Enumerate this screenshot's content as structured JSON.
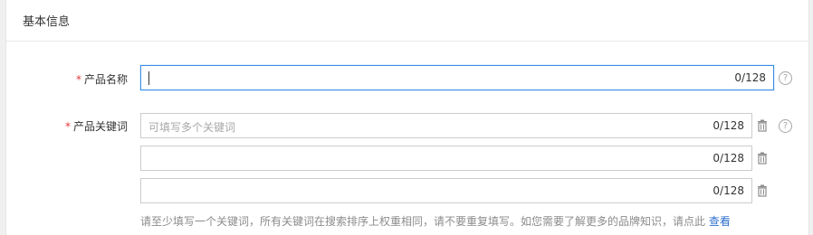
{
  "section": {
    "title": "基本信息"
  },
  "form": {
    "product_name": {
      "required_mark": "*",
      "label": "产品名称",
      "value": "",
      "counter": "0/128",
      "help_icon": "question-circle-icon"
    },
    "keywords": {
      "required_mark": "*",
      "label": "产品关键词",
      "fields": [
        {
          "value": "",
          "placeholder": "可填写多个关键词",
          "counter": "0/128"
        },
        {
          "value": "",
          "placeholder": "",
          "counter": "0/128"
        },
        {
          "value": "",
          "placeholder": "",
          "counter": "0/128"
        }
      ],
      "delete_icon": "trash-icon",
      "help_icon": "question-circle-icon",
      "hint_text": "请至少填写一个关键词，所有关键词在搜索排序上权重相同，请不要重复填写。如您需要了解更多的品牌知识，请点此 ",
      "hint_link": "查看"
    }
  },
  "colors": {
    "required": "#e4393c",
    "focus_border": "#3a8ee6",
    "link": "#2f6fcf"
  }
}
